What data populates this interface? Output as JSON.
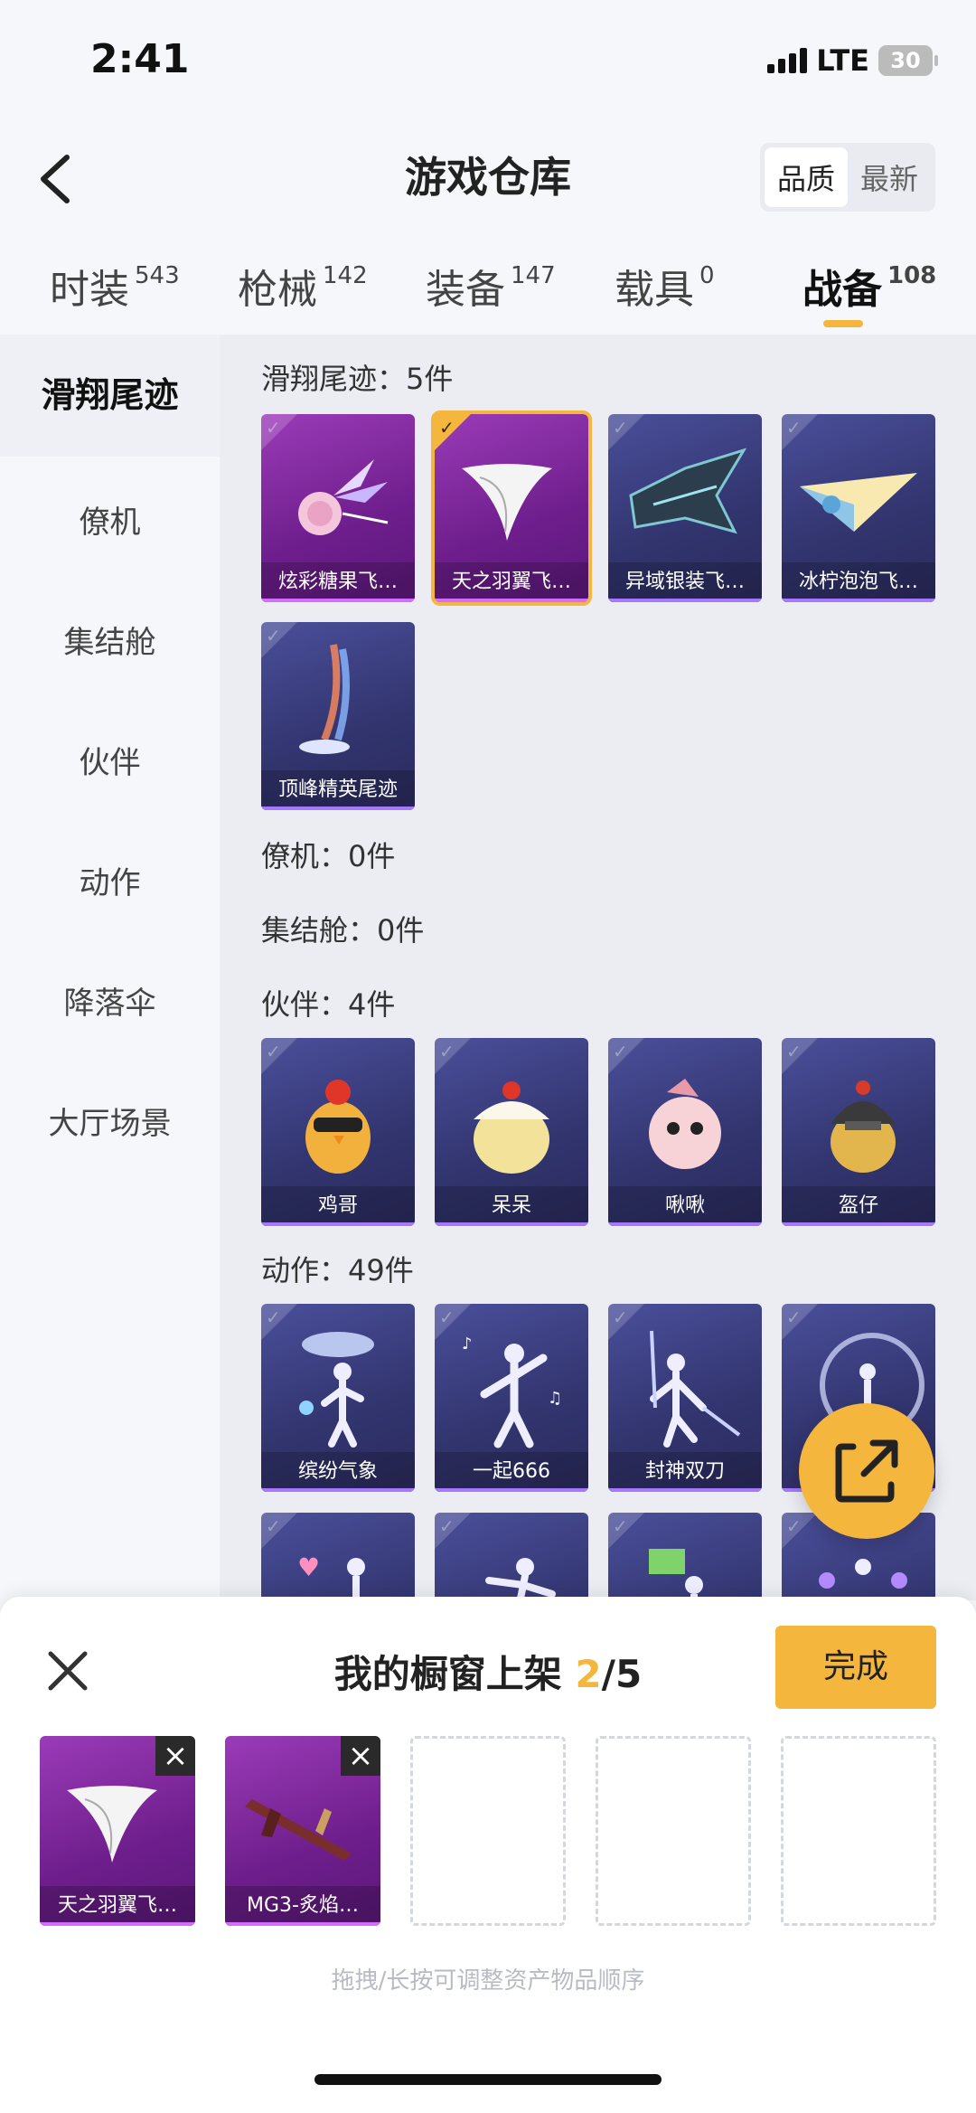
{
  "status_bar": {
    "time": "2:41",
    "network": "LTE",
    "battery": "30"
  },
  "header": {
    "title": "游戏仓库",
    "sort_options": [
      "品质",
      "最新"
    ],
    "sort_active": 0
  },
  "tabs": [
    {
      "label": "时装",
      "count": "543"
    },
    {
      "label": "枪械",
      "count": "142"
    },
    {
      "label": "装备",
      "count": "147"
    },
    {
      "label": "载具",
      "count": "0"
    },
    {
      "label": "战备",
      "count": "108"
    }
  ],
  "active_tab": 4,
  "sidebar": [
    "滑翔尾迹",
    "僚机",
    "集结舱",
    "伙伴",
    "动作",
    "降落伞",
    "大厅场景"
  ],
  "sections": {
    "glide": {
      "title": "滑翔尾迹：5件",
      "items": [
        "炫彩糖果飞…",
        "天之羽翼飞…",
        "异域银装飞…",
        "冰柠泡泡飞…",
        "顶峰精英尾迹"
      ]
    },
    "wingman": {
      "title": "僚机：0件"
    },
    "capsule": {
      "title": "集结舱：0件"
    },
    "partner": {
      "title": "伙伴：4件",
      "items": [
        "鸡哥",
        "呆呆",
        "啾啾",
        "盔仔"
      ]
    },
    "emote": {
      "title": "动作：49件",
      "items": [
        "缤纷气象",
        "一起666",
        "封神双刀"
      ]
    }
  },
  "sheet": {
    "title_prefix": "我的橱窗上架 ",
    "count": "2",
    "total": "/5",
    "done_label": "完成",
    "slots": [
      "天之羽翼飞…",
      "MG3-炙焰…"
    ],
    "hint": "拖拽/长按可调整资产物品顺序"
  },
  "icons": {
    "back": "back-arrow-icon",
    "close": "close-icon",
    "share": "share-icon",
    "remove": "remove-icon"
  },
  "colors": {
    "accent": "#f4b63c",
    "purple_card": "#7e2a9e",
    "blue_card": "#373a7a"
  }
}
